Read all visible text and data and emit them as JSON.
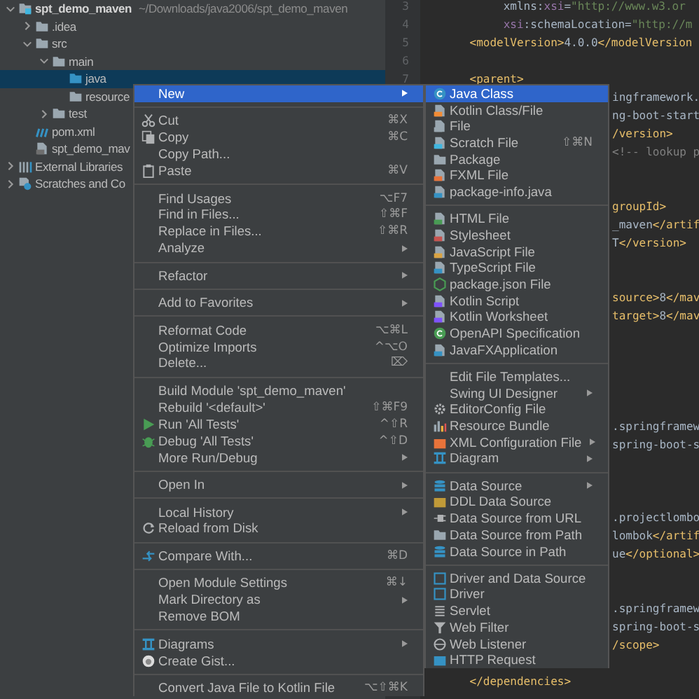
{
  "project_tree": [
    {
      "label": "spt_demo_maven",
      "hint": "~/Downloads/java2006/spt_demo_maven",
      "kind": "module",
      "expanded": true,
      "selected": false,
      "children": [
        {
          "label": ".idea",
          "kind": "folder",
          "color": "#9aa7b0",
          "expanded": false,
          "selected": false
        },
        {
          "label": "src",
          "kind": "folder",
          "color": "#9aa7b0",
          "expanded": true,
          "selected": false,
          "children": [
            {
              "label": "main",
              "kind": "folder",
              "color": "#9aa7b0",
              "expanded": true,
              "selected": false,
              "children": [
                {
                  "label": "java",
                  "kind": "folder",
                  "color": "#3592c4",
                  "selected": true
                },
                {
                  "label": "resource",
                  "kind": "folder",
                  "color": "#9aa7b0",
                  "selected": false
                }
              ]
            },
            {
              "label": "test",
              "kind": "folder",
              "color": "#9aa7b0",
              "expanded": false,
              "selected": false
            }
          ]
        },
        {
          "label": "pom.xml",
          "kind": "stripes",
          "selected": false
        },
        {
          "label": "spt_demo_mav",
          "kind": "document",
          "color": "#6e6e6e",
          "selected": false
        }
      ]
    },
    {
      "label": "External Libraries",
      "kind": "libraries",
      "expanded": false,
      "selected": false
    },
    {
      "label": "Scratches and Co",
      "kind": "scratches",
      "expanded": false,
      "selected": false
    }
  ],
  "editor": {
    "line_numbers": [
      "3",
      "4",
      "5",
      "6",
      "7"
    ],
    "lines": [
      {
        "kind": "code",
        "clipped": false,
        "segments": [
          {
            "kind": "text",
            "text": "         xmlns:"
          },
          {
            "kind": "ns",
            "text": "xsi"
          },
          {
            "kind": "text",
            "text": "="
          },
          {
            "kind": "string",
            "text": "\"http://www.w3.or"
          }
        ]
      },
      {
        "kind": "code",
        "clipped": false,
        "segments": [
          {
            "kind": "ns",
            "text": "         xsi"
          },
          {
            "kind": "text",
            "text": ":schemaLocation="
          },
          {
            "kind": "string",
            "text": "\"http://m"
          }
        ]
      },
      {
        "kind": "code",
        "clipped": false,
        "segments": [
          {
            "kind": "tag",
            "text": "    <modelVersion>"
          },
          {
            "kind": "text",
            "text": "4.0.0"
          },
          {
            "kind": "tag",
            "text": "</modelVersion"
          }
        ]
      },
      {
        "kind": "blank"
      },
      {
        "kind": "code",
        "clipped": false,
        "segments": [
          {
            "kind": "tag",
            "text": "    <parent>"
          }
        ]
      },
      {
        "kind": "code",
        "clipped": true,
        "segments": [
          {
            "kind": "text",
            "text": "ingframework."
          }
        ]
      },
      {
        "kind": "code",
        "clipped": true,
        "segments": [
          {
            "kind": "text",
            "text": "ng-boot-start"
          }
        ]
      },
      {
        "kind": "code",
        "clipped": true,
        "segments": [
          {
            "kind": "tag",
            "text": "/version>"
          }
        ]
      },
      {
        "kind": "code",
        "clipped": true,
        "segments": [
          {
            "kind": "comment",
            "text": "<!-- lookup p"
          }
        ]
      },
      {
        "kind": "blank"
      },
      {
        "kind": "blank"
      },
      {
        "kind": "code",
        "clipped": true,
        "segments": [
          {
            "kind": "tag",
            "text": "groupId>"
          }
        ]
      },
      {
        "kind": "code",
        "clipped": true,
        "segments": [
          {
            "kind": "text",
            "text": "_maven"
          },
          {
            "kind": "tag",
            "text": "</artif"
          }
        ]
      },
      {
        "kind": "code",
        "clipped": true,
        "segments": [
          {
            "kind": "text",
            "text": "T"
          },
          {
            "kind": "tag",
            "text": "</version>"
          }
        ]
      },
      {
        "kind": "blank"
      },
      {
        "kind": "blank"
      },
      {
        "kind": "code",
        "clipped": true,
        "segments": [
          {
            "kind": "tag",
            "text": "source>"
          },
          {
            "kind": "text",
            "text": "8"
          },
          {
            "kind": "tag",
            "text": "</mav"
          }
        ]
      },
      {
        "kind": "code",
        "clipped": true,
        "segments": [
          {
            "kind": "tag",
            "text": "target>"
          },
          {
            "kind": "text",
            "text": "8"
          },
          {
            "kind": "tag",
            "text": "</mav"
          }
        ]
      },
      {
        "kind": "blank"
      },
      {
        "kind": "blank"
      },
      {
        "kind": "blank"
      },
      {
        "kind": "blank"
      },
      {
        "kind": "blank"
      },
      {
        "kind": "code",
        "clipped": true,
        "segments": [
          {
            "kind": "text",
            "text": ".springframew"
          }
        ]
      },
      {
        "kind": "code",
        "clipped": true,
        "segments": [
          {
            "kind": "text",
            "text": "spring-boot-s"
          }
        ]
      },
      {
        "kind": "blank"
      },
      {
        "kind": "blank"
      },
      {
        "kind": "blank"
      },
      {
        "kind": "code",
        "clipped": true,
        "segments": [
          {
            "kind": "text",
            "text": ".projectlombo"
          }
        ]
      },
      {
        "kind": "code",
        "clipped": true,
        "segments": [
          {
            "kind": "text",
            "text": "lombok"
          },
          {
            "kind": "tag",
            "text": "</artif"
          }
        ]
      },
      {
        "kind": "code",
        "clipped": true,
        "segments": [
          {
            "kind": "text",
            "text": "ue"
          },
          {
            "kind": "tag",
            "text": "</optional>"
          }
        ]
      },
      {
        "kind": "blank"
      },
      {
        "kind": "blank"
      },
      {
        "kind": "code",
        "clipped": true,
        "segments": [
          {
            "kind": "text",
            "text": ".springframew"
          }
        ]
      },
      {
        "kind": "code",
        "clipped": true,
        "segments": [
          {
            "kind": "text",
            "text": "spring-boot-s"
          }
        ]
      },
      {
        "kind": "code",
        "clipped": true,
        "segments": [
          {
            "kind": "tag",
            "text": "/scope>"
          }
        ]
      },
      {
        "kind": "blank"
      },
      {
        "kind": "code",
        "clipped": false,
        "segments": [
          {
            "kind": "tag",
            "text": "    </dependencies>"
          }
        ]
      }
    ]
  },
  "context_menu": {
    "groups": [
      {
        "items": [
          {
            "label": "New",
            "kind": "plain",
            "submenu": true,
            "selected": true
          }
        ]
      },
      {
        "items": [
          {
            "label": "Cut",
            "shortcut": "⌘X",
            "kind": "scissors",
            "submenu": false,
            "selected": false
          },
          {
            "label": "Copy",
            "shortcut": "⌘C",
            "kind": "pages",
            "submenu": false,
            "selected": false
          },
          {
            "label": "Copy Path...",
            "kind": "plain",
            "submenu": false,
            "selected": false
          },
          {
            "label": "Paste",
            "shortcut": "⌘V",
            "kind": "clipboard",
            "submenu": false,
            "selected": false
          }
        ]
      },
      {
        "items": [
          {
            "label": "Find Usages",
            "shortcut": "⌥F7",
            "kind": "plain",
            "submenu": false,
            "selected": false
          },
          {
            "label": "Find in Files...",
            "shortcut": "⇧⌘F",
            "kind": "plain",
            "submenu": false,
            "selected": false
          },
          {
            "label": "Replace in Files...",
            "shortcut": "⇧⌘R",
            "kind": "plain",
            "submenu": false,
            "selected": false
          },
          {
            "label": "Analyze",
            "kind": "plain",
            "submenu": true,
            "selected": false
          }
        ]
      },
      {
        "items": [
          {
            "label": "Refactor",
            "kind": "plain",
            "submenu": true,
            "selected": false
          }
        ]
      },
      {
        "items": [
          {
            "label": "Add to Favorites",
            "kind": "plain",
            "submenu": true,
            "selected": false
          }
        ]
      },
      {
        "items": [
          {
            "label": "Reformat Code",
            "shortcut": "⌥⌘L",
            "kind": "plain",
            "submenu": false,
            "selected": false
          },
          {
            "label": "Optimize Imports",
            "shortcut": "^⌥O",
            "kind": "plain",
            "submenu": false,
            "selected": false
          },
          {
            "label": "Delete...",
            "shortcut": "⌦",
            "kind": "plain",
            "submenu": false,
            "selected": false
          }
        ]
      },
      {
        "items": [
          {
            "label": "Build Module 'spt_demo_maven'",
            "kind": "plain",
            "submenu": false,
            "selected": false
          },
          {
            "label": "Rebuild '<default>'",
            "shortcut": "⇧⌘F9",
            "kind": "plain",
            "submenu": false,
            "selected": false
          },
          {
            "label": "Run 'All Tests'",
            "shortcut": "^⇧R",
            "kind": "play",
            "submenu": false,
            "selected": false
          },
          {
            "label": "Debug 'All Tests'",
            "shortcut": "^⇧D",
            "kind": "bug",
            "submenu": false,
            "selected": false
          },
          {
            "label": "More Run/Debug",
            "kind": "plain",
            "submenu": true,
            "selected": false
          }
        ]
      },
      {
        "items": [
          {
            "label": "Open In",
            "kind": "plain",
            "submenu": true,
            "selected": false
          }
        ]
      },
      {
        "items": [
          {
            "label": "Local History",
            "kind": "plain",
            "submenu": true,
            "selected": false
          },
          {
            "label": "Reload from Disk",
            "kind": "reload",
            "submenu": false,
            "selected": false
          }
        ]
      },
      {
        "items": [
          {
            "label": "Compare With...",
            "shortcut": "⌘D",
            "kind": "arrows",
            "submenu": false,
            "selected": false
          }
        ]
      },
      {
        "items": [
          {
            "label": "Open Module Settings",
            "shortcut": "⌘↓",
            "kind": "plain",
            "submenu": false,
            "selected": false
          },
          {
            "label": "Mark Directory as",
            "kind": "plain",
            "submenu": true,
            "selected": false
          },
          {
            "label": "Remove BOM",
            "kind": "plain",
            "submenu": false,
            "selected": false
          }
        ]
      },
      {
        "items": [
          {
            "label": "Diagrams",
            "kind": "diagram",
            "submenu": true,
            "selected": false
          },
          {
            "label": "Create Gist...",
            "kind": "logo",
            "submenu": false,
            "selected": false
          }
        ]
      },
      {
        "items": [
          {
            "label": "Convert Java File to Kotlin File",
            "shortcut": "⌥⇧⌘K",
            "kind": "plain",
            "submenu": false,
            "selected": false
          }
        ]
      }
    ]
  },
  "new_submenu": {
    "groups": [
      {
        "items": [
          {
            "label": "Java Class",
            "kind": "circle",
            "color": "#3592c4",
            "submenu": false,
            "selected": true
          },
          {
            "label": "Kotlin Class/File",
            "kind": "document",
            "color": "#f28c35",
            "submenu": false,
            "selected": false
          },
          {
            "label": "File",
            "kind": "document",
            "color": "#9aa7b0",
            "submenu": false,
            "selected": false
          },
          {
            "label": "Scratch File",
            "shortcut": "⇧⌘N",
            "kind": "document",
            "color": "#40b6e0",
            "submenu": false,
            "selected": false
          },
          {
            "label": "Package",
            "kind": "folder",
            "color": "#9aa7b0",
            "submenu": false,
            "selected": false
          },
          {
            "label": "FXML File",
            "kind": "document",
            "color": "#e8733a",
            "submenu": false,
            "selected": false
          },
          {
            "label": "package-info.java",
            "kind": "document",
            "color": "#3592c4",
            "submenu": false,
            "selected": false
          }
        ]
      },
      {
        "items": [
          {
            "label": "HTML File",
            "kind": "document",
            "color": "#499c54",
            "submenu": false,
            "selected": false
          },
          {
            "label": "Stylesheet",
            "kind": "document",
            "color": "#c75450",
            "submenu": false,
            "selected": false
          },
          {
            "label": "JavaScript File",
            "kind": "document",
            "color": "#d9a343",
            "submenu": false,
            "selected": false
          },
          {
            "label": "TypeScript File",
            "kind": "document",
            "color": "#3592c4",
            "submenu": false,
            "selected": false
          },
          {
            "label": "package.json File",
            "kind": "hexagon",
            "color": "#499c54",
            "submenu": false,
            "selected": false
          },
          {
            "label": "Kotlin Script",
            "kind": "document",
            "color": "#7f52ff",
            "submenu": false,
            "selected": false
          },
          {
            "label": "Kotlin Worksheet",
            "kind": "document",
            "color": "#7f52ff",
            "submenu": false,
            "selected": false
          },
          {
            "label": "OpenAPI Specification",
            "kind": "circle",
            "color": "#499c54",
            "submenu": false,
            "selected": false
          },
          {
            "label": "JavaFXApplication",
            "kind": "document",
            "color": "#3592c4",
            "submenu": false,
            "selected": false
          }
        ]
      },
      {
        "items": [
          {
            "label": "Edit File Templates...",
            "kind": "plain",
            "submenu": false,
            "selected": false
          },
          {
            "label": "Swing UI Designer",
            "kind": "plain",
            "submenu": true,
            "selected": false
          },
          {
            "label": "EditorConfig File",
            "kind": "gear",
            "submenu": false,
            "selected": false
          },
          {
            "label": "Resource Bundle",
            "kind": "bars",
            "submenu": false,
            "selected": false
          },
          {
            "label": "XML Configuration File",
            "kind": "box",
            "color": "#e8733a",
            "submenu": true,
            "selected": false
          },
          {
            "label": "Diagram",
            "kind": "diagram",
            "submenu": true,
            "selected": false
          }
        ]
      },
      {
        "items": [
          {
            "label": "Data Source",
            "kind": "database",
            "submenu": true,
            "selected": false
          },
          {
            "label": "DDL Data Source",
            "kind": "box",
            "color": "#c09a38",
            "submenu": false,
            "selected": false
          },
          {
            "label": "Data Source from URL",
            "kind": "plug",
            "submenu": false,
            "selected": false
          },
          {
            "label": "Data Source from Path",
            "kind": "folder",
            "color": "#9aa7b0",
            "submenu": false,
            "selected": false
          },
          {
            "label": "Data Source in Path",
            "kind": "database",
            "submenu": false,
            "selected": false
          }
        ]
      },
      {
        "items": [
          {
            "label": "Driver and Data Source",
            "kind": "frame",
            "submenu": false,
            "selected": false
          },
          {
            "label": "Driver",
            "kind": "frame",
            "submenu": false,
            "selected": false
          },
          {
            "label": "Servlet",
            "kind": "list",
            "submenu": false,
            "selected": false
          },
          {
            "label": "Web Filter",
            "kind": "funnel",
            "submenu": false,
            "selected": false
          },
          {
            "label": "Web Listener",
            "kind": "globe",
            "submenu": false,
            "selected": false
          },
          {
            "label": "HTTP Request",
            "kind": "box",
            "color": "#3592c4",
            "submenu": false,
            "selected": false
          }
        ]
      }
    ]
  }
}
